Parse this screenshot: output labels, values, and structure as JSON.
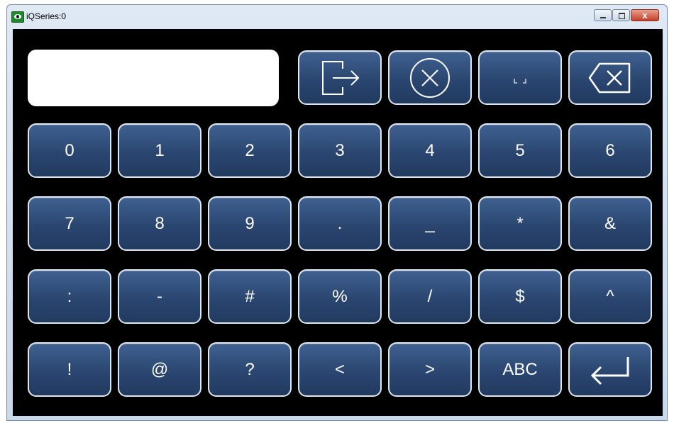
{
  "window": {
    "title": "iQSeries:0",
    "close_glyph": "x"
  },
  "entry": {
    "value": ""
  },
  "top_keys": [
    {
      "icon": "exit-icon"
    },
    {
      "icon": "clear-icon"
    },
    {
      "icon": "space-icon"
    },
    {
      "icon": "backspace-icon"
    }
  ],
  "rows": [
    [
      "0",
      "1",
      "2",
      "3",
      "4",
      "5",
      "6"
    ],
    [
      "7",
      "8",
      "9",
      ".",
      "_",
      "*",
      "&"
    ],
    [
      ":",
      "-",
      "#",
      "%",
      "/",
      "$",
      "^"
    ],
    [
      "!",
      "@",
      "?",
      "<",
      ">",
      "ABC"
    ]
  ],
  "enter_key": {
    "icon": "enter-icon"
  }
}
